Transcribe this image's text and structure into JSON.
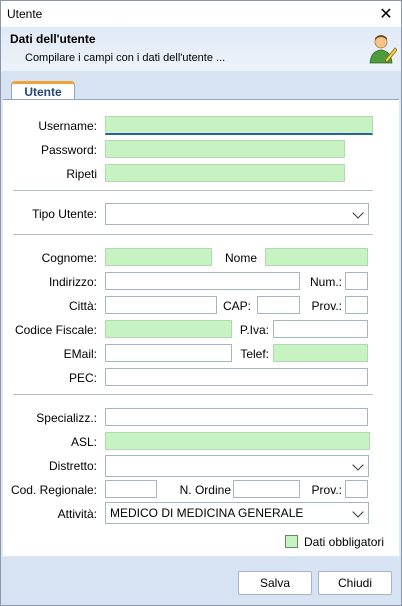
{
  "window": {
    "title": "Utente"
  },
  "header": {
    "title": "Dati dell'utente",
    "subtitle": "Compilare i campi con i dati dell'utente ..."
  },
  "tabs": [
    {
      "label": "Utente"
    }
  ],
  "form": {
    "username": {
      "label": "Username:",
      "value": ""
    },
    "password": {
      "label": "Password:",
      "value": ""
    },
    "ripeti": {
      "label": "Ripeti",
      "value": ""
    },
    "tipo_utente": {
      "label": "Tipo Utente:",
      "value": ""
    },
    "cognome": {
      "label": "Cognome:",
      "value": ""
    },
    "nome": {
      "label": "Nome",
      "value": ""
    },
    "indirizzo": {
      "label": "Indirizzo:",
      "value": ""
    },
    "num": {
      "label": "Num.:",
      "value": ""
    },
    "citta": {
      "label": "Città:",
      "value": ""
    },
    "cap": {
      "label": "CAP:",
      "value": ""
    },
    "prov1": {
      "label": "Prov.:",
      "value": ""
    },
    "codice_fiscale": {
      "label": "Codice Fiscale:",
      "value": ""
    },
    "piva": {
      "label": "P.Iva:",
      "value": ""
    },
    "email": {
      "label": "EMail:",
      "value": ""
    },
    "telef": {
      "label": "Telef:",
      "value": ""
    },
    "pec": {
      "label": "PEC:",
      "value": ""
    },
    "specializz": {
      "label": "Specializz.:",
      "value": ""
    },
    "asl": {
      "label": "ASL:",
      "value": ""
    },
    "distretto": {
      "label": "Distretto:",
      "value": ""
    },
    "cod_regionale": {
      "label": "Cod. Regionale:",
      "value": ""
    },
    "n_ordine": {
      "label": "N. Ordine",
      "value": ""
    },
    "prov2": {
      "label": "Prov.:",
      "value": ""
    },
    "attivita": {
      "label": "Attività:",
      "value": "MEDICO DI MEDICINA GENERALE"
    }
  },
  "legend": {
    "label": "Dati obbligatori"
  },
  "buttons": {
    "save": "Salva",
    "close": "Chiudi"
  },
  "colors": {
    "required_field": "#c7f3c3",
    "tab_accent": "#f0a23a",
    "frame_bg": "#dde8f5"
  },
  "icons": {
    "close": "close-icon",
    "user": "user-edit-icon"
  }
}
